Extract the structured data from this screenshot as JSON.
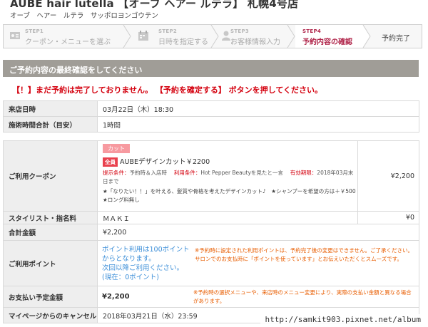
{
  "shop": {
    "title": "AUBE hair lutella 【オーブ ヘアー ルテラ】 札幌4号店",
    "kana": "オーブ　ヘアー　ルテラ　サッポロヨンゴウテン"
  },
  "steps": [
    {
      "num": "STEP1",
      "label": "クーポン・メニューを選ぶ",
      "icon": "coupon-icon"
    },
    {
      "num": "STEP2",
      "label": "日時を指定する",
      "icon": "calendar-icon"
    },
    {
      "num": "STEP3",
      "label": "お客様情報入力",
      "icon": "person-icon"
    },
    {
      "num": "STEP4",
      "label": "予約内容の確認",
      "icon": ""
    },
    {
      "num": "",
      "label": "予約完了",
      "icon": ""
    }
  ],
  "confirm": {
    "heading": "ご予約内容の最終確認をしてください",
    "warning": "【！】まだ予約は完了しておりません。 【予約を確定する】 ボタンを押してください。"
  },
  "details": {
    "visit_label": "来店日時",
    "visit_value": "03月22日（木）18:30",
    "duration_label": "施術時間合計（目安）",
    "duration_value": "1時間",
    "coupon_label": "ご利用クーポン",
    "coupon_tag": "カット",
    "coupon_all": "全員",
    "coupon_name": "AUBEデザインカット￥2200",
    "coupon_cond1_label": "提示条件：",
    "coupon_cond1": "予約時＆入店時",
    "coupon_cond2_label": "利用条件：",
    "coupon_cond2": "Hot Pepper Beautyを見たと一言",
    "coupon_cond3_label": "有効期限：",
    "coupon_cond3": "2018年03月末日まで",
    "coupon_desc": "★「なりたい！！」を叶える、髪質や骨格を考えたデザインカット♪　★シャンプーを希望の方は＋￥500　★ロング料無し",
    "coupon_price": "¥2,200",
    "stylist_label": "スタイリスト・指名料",
    "stylist_value": "ＭＡＫＩ",
    "stylist_price": "¥0",
    "total_label": "合計金額",
    "total_value": "¥2,200",
    "points_label": "ご利用ポイント",
    "points_line1": "ポイント利用は100ポイント",
    "points_line2": "からとなります。",
    "points_line3": "次回以降ご利用ください。",
    "points_line4": "(現在：0ポイント)",
    "points_note1": "※予約時に設定された利用ポイントは、予約完了後の変更はできません。ご了承ください。",
    "points_note2": "サロンでのお支払時に「ポイントを使っています」とお伝えいただくとスムーズです。",
    "pay_label": "お支払い予定金額",
    "pay_value": "¥2,200",
    "pay_note": "※予約時の選択メニューや、来店時のメニュー変更により、実際の支払い金額と異なる場合があります。",
    "cancel_label": "マイページからのキャンセル",
    "cancel_value": "2018年03月21日（水）23:59"
  },
  "watermark": "http://samkit903.pixnet.net/album"
}
